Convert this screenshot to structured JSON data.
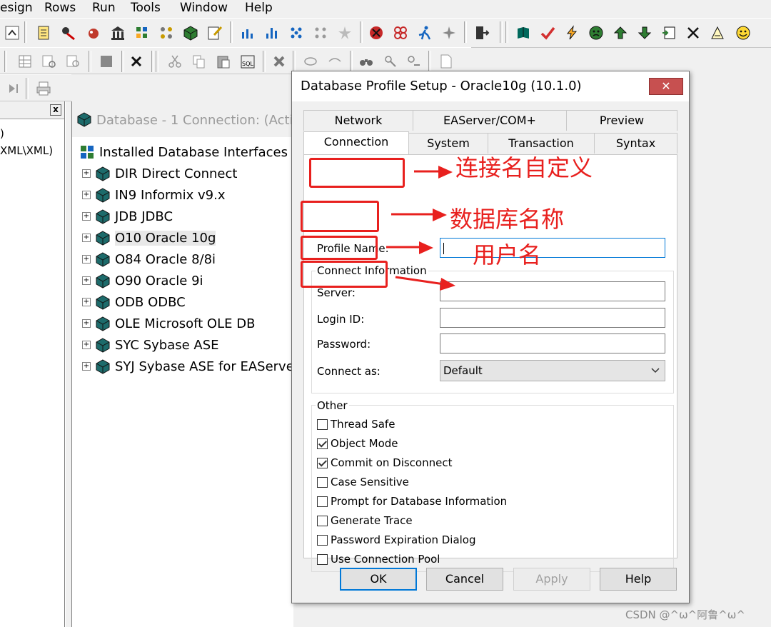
{
  "menu": [
    "esign",
    "Rows",
    "Run",
    "Tools",
    "Window",
    "Help"
  ],
  "side_panel": {
    "line1": ")",
    "line2": "XML\\XML)",
    "close": "x"
  },
  "db_panel": {
    "title": "Database - 1 Connection: (Active",
    "root": "Installed Database Interfaces",
    "interfaces": [
      "DIR Direct Connect",
      "IN9 Informix v9.x",
      "JDB JDBC",
      "O10 Oracle 10g",
      "O84 Oracle 8/8i",
      "O90 Oracle 9i",
      "ODB ODBC",
      "OLE Microsoft OLE DB",
      "SYC Sybase ASE",
      "SYJ Sybase ASE for EAServe"
    ],
    "selected_index": 3,
    "expander": "+"
  },
  "dialog": {
    "title": "Database Profile Setup - Oracle10g (10.1.0)",
    "close": "✕",
    "tabs_back": [
      "Network",
      "EAServer/COM+",
      "Preview"
    ],
    "tabs_front": [
      "Connection",
      "System",
      "Transaction",
      "Syntax"
    ],
    "active_tab": "Connection",
    "profile_name_label": "Profile Name:",
    "profile_name_value": "",
    "connect_info_label": "Connect Information",
    "server_label": "Server:",
    "server_value": "",
    "login_label": "Login ID:",
    "login_value": "",
    "password_label": "Password:",
    "password_value": "",
    "connect_as_label": "Connect as:",
    "connect_as_value": "Default",
    "other_label": "Other",
    "options": [
      {
        "label": "Thread Safe",
        "checked": false
      },
      {
        "label": "Object Mode",
        "checked": true
      },
      {
        "label": "Commit on Disconnect",
        "checked": true
      },
      {
        "label": "Case Sensitive",
        "checked": false
      },
      {
        "label": "Prompt for Database Information",
        "checked": false
      },
      {
        "label": "Generate Trace",
        "checked": false
      },
      {
        "label": "Password Expiration Dialog",
        "checked": false
      },
      {
        "label": "Use Connection Pool",
        "checked": false
      }
    ],
    "buttons": {
      "ok": "OK",
      "cancel": "Cancel",
      "apply": "Apply",
      "help": "Help"
    }
  },
  "annotations": {
    "profile_note": "连接名自定义",
    "server_note": "数据库名称",
    "login_note": "用户名"
  },
  "watermark": "CSDN @^ω^阿鲁^ω^",
  "colors": {
    "annotation_red": "#e8201e",
    "focus_blue": "#0078d7",
    "close_red": "#c75050"
  }
}
